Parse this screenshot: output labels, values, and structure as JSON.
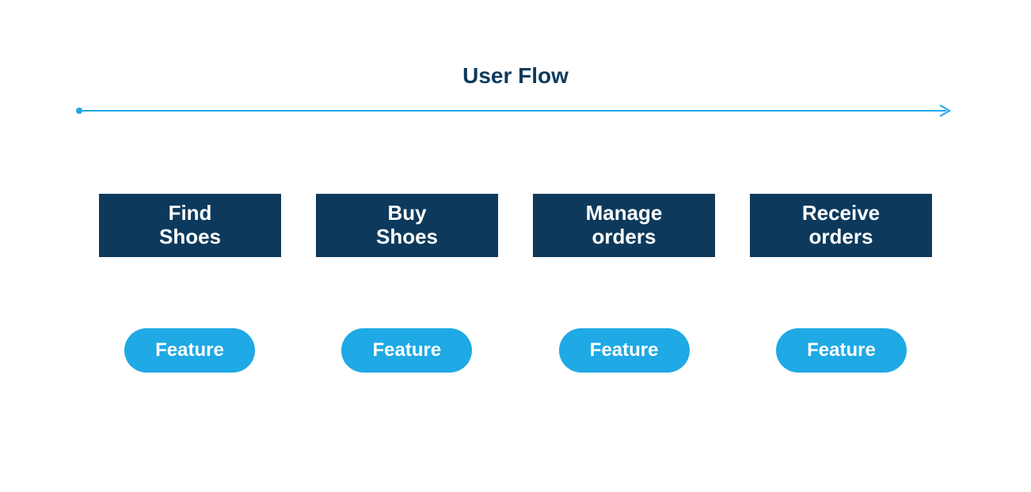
{
  "title": "User Flow",
  "colors": {
    "darkBlue": "#0d3a5c",
    "lightBlue": "#1fa9e5",
    "arrowBlue": "#1fa9e5"
  },
  "steps": [
    {
      "label": "Find\nShoes"
    },
    {
      "label": "Buy\nShoes"
    },
    {
      "label": "Manage\norders"
    },
    {
      "label": "Receive\norders"
    }
  ],
  "features": [
    {
      "label": "Feature"
    },
    {
      "label": "Feature"
    },
    {
      "label": "Feature"
    },
    {
      "label": "Feature"
    }
  ]
}
